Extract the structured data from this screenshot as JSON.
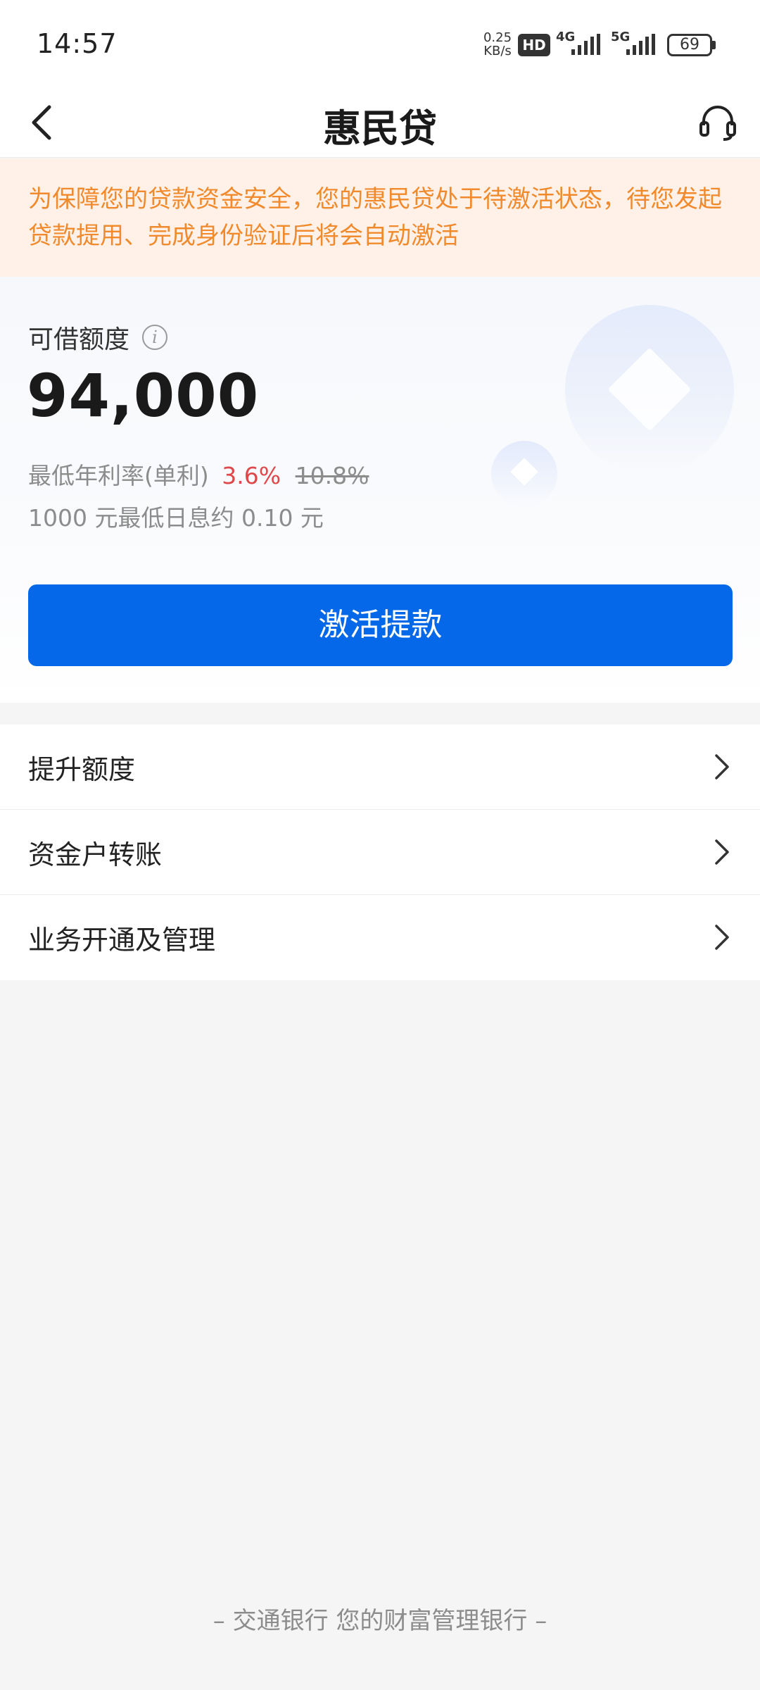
{
  "status_bar": {
    "time": "14:57",
    "net_speed_value": "0.25",
    "net_speed_unit": "KB/s",
    "hd_badge": "HD",
    "network_1": "4G",
    "network_2": "5G",
    "battery": "69"
  },
  "header": {
    "title": "惠民贷",
    "back_icon": "chevron-left-icon",
    "service_icon": "headset-icon"
  },
  "notice": {
    "text": "为保障您的贷款资金安全，您的惠民贷处于待激活状态，待您发起贷款提用、完成身份验证后将会自动激活",
    "color": "#f08a2c",
    "background": "#fff1e8"
  },
  "credit": {
    "label": "可借额度",
    "info_icon_glyph": "i",
    "amount": "94,000",
    "rate_prefix": "最低年利率(单利)",
    "rate_current": "3.6%",
    "rate_original": "10.8%",
    "daily_interest": "1000 元最低日息约 0.10 元",
    "rate_color": "#e0474a"
  },
  "activate_button": {
    "label": "激活提款",
    "color": "#0568e8"
  },
  "menu": {
    "items": [
      {
        "label": "提升额度"
      },
      {
        "label": "资金户转账"
      },
      {
        "label": "业务开通及管理"
      }
    ]
  },
  "footer": {
    "text": "– 交通银行 您的财富管理银行 –"
  }
}
